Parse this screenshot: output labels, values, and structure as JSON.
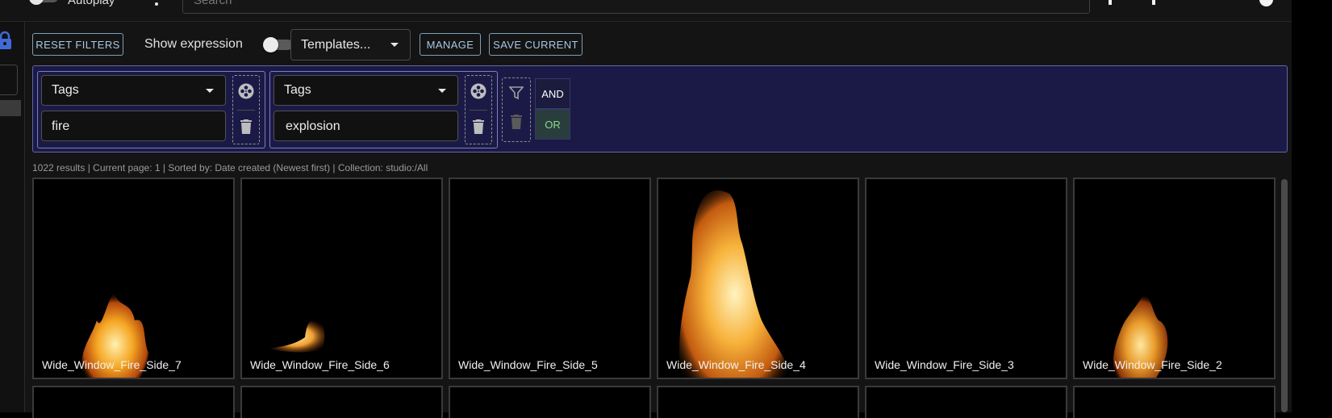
{
  "topbar": {
    "autoplay_label": "Autoplay",
    "search_placeholder": "Search"
  },
  "toolbar": {
    "reset_label": "RESET FILTERS",
    "show_expression_label": "Show expression",
    "show_expression_on": false,
    "templates_label": "Templates...",
    "manage_label": "MANAGE",
    "save_current_label": "SAVE CURRENT"
  },
  "filters": [
    {
      "field": "Tags",
      "value": "fire"
    },
    {
      "field": "Tags",
      "value": "explosion"
    }
  ],
  "logic": {
    "and_label": "AND",
    "or_label": "OR",
    "selected": "OR"
  },
  "results_info": "1022 results | Current page: 1 | Sorted by: Date created (Newest first) | Collection: studio:/All",
  "assets": [
    {
      "name": "Wide_Window_Fire_Side_7"
    },
    {
      "name": "Wide_Window_Fire_Side_6"
    },
    {
      "name": "Wide_Window_Fire_Side_5"
    },
    {
      "name": "Wide_Window_Fire_Side_4"
    },
    {
      "name": "Wide_Window_Fire_Side_3"
    },
    {
      "name": "Wide_Window_Fire_Side_2"
    }
  ],
  "colors": {
    "background": "#141414",
    "filter_panel": "#1b1a47",
    "accent_button": "#a8c8e2",
    "or_active": "#8dd68d"
  }
}
